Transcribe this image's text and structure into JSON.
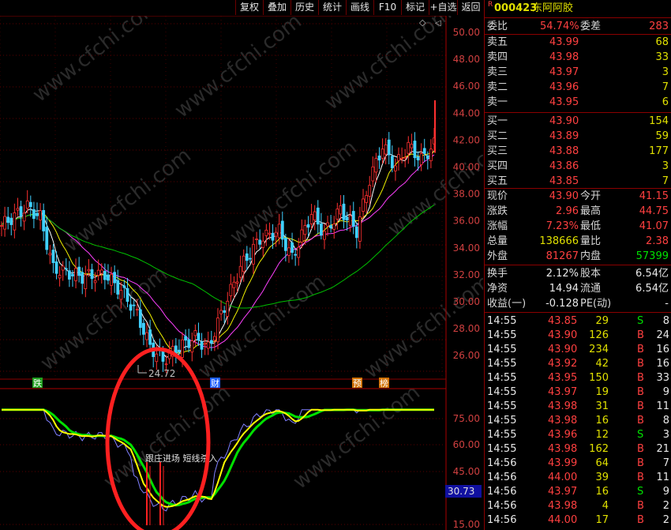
{
  "toolbar": {
    "items": [
      "复权",
      "叠加",
      "历史",
      "统计",
      "画线",
      "F10",
      "标记",
      "+自选",
      "返回"
    ]
  },
  "price_axis": [
    "50.00",
    "48.00",
    "46.00",
    "44.00",
    "42.00",
    "40.00",
    "38.00",
    "36.00",
    "34.00",
    "32.00",
    "30.00",
    "28.00",
    "26.00"
  ],
  "indicator_axis": [
    "75.00",
    "60.00",
    "45.00",
    "15.00"
  ],
  "indicator_value": "30.73",
  "low_marker": "24.72",
  "event_markers": [
    "跌",
    "财",
    "预",
    "榜"
  ],
  "signal_text": "跟庄进场 短线杀入",
  "watermark": "www.cfchi.com",
  "quote": {
    "marker": "R",
    "code": "000423",
    "name": "东阿阿胶",
    "weibi_label": "委比",
    "weibi": "54.74%",
    "weicha_label": "委差",
    "weicha": "283",
    "asks": [
      {
        "label": "卖五",
        "price": "43.99",
        "vol": "68"
      },
      {
        "label": "卖四",
        "price": "43.98",
        "vol": "33"
      },
      {
        "label": "卖三",
        "price": "43.97",
        "vol": "3"
      },
      {
        "label": "卖二",
        "price": "43.96",
        "vol": "7"
      },
      {
        "label": "卖一",
        "price": "43.95",
        "vol": "6"
      }
    ],
    "bids": [
      {
        "label": "买一",
        "price": "43.90",
        "vol": "154"
      },
      {
        "label": "买二",
        "price": "43.89",
        "vol": "59"
      },
      {
        "label": "买三",
        "price": "43.88",
        "vol": "177"
      },
      {
        "label": "买四",
        "price": "43.86",
        "vol": "3"
      },
      {
        "label": "买五",
        "price": "43.85",
        "vol": "7"
      }
    ],
    "stats": [
      {
        "l1": "现价",
        "v1": "43.90",
        "c1": "red",
        "l2": "今开",
        "v2": "41.15",
        "c2": "red"
      },
      {
        "l1": "涨跌",
        "v1": "2.96",
        "c1": "red",
        "l2": "最高",
        "v2": "44.75",
        "c2": "red"
      },
      {
        "l1": "涨幅",
        "v1": "7.23%",
        "c1": "red",
        "l2": "最低",
        "v2": "41.07",
        "c2": "red"
      },
      {
        "l1": "总量",
        "v1": "138666",
        "c1": "yellow",
        "l2": "量比",
        "v2": "2.38",
        "c2": "red"
      },
      {
        "l1": "外盘",
        "v1": "81267",
        "c1": "red",
        "l2": "内盘",
        "v2": "57399",
        "c2": "green"
      }
    ],
    "stats2": [
      {
        "l1": "换手",
        "v1": "2.12%",
        "l2": "股本",
        "v2": "6.54亿"
      },
      {
        "l1": "净资",
        "v1": "14.94",
        "l2": "流通",
        "v2": "6.54亿"
      },
      {
        "l1": "收益(一)",
        "v1": "-0.128",
        "l2": "PE(动)",
        "v2": "-"
      }
    ],
    "ticks": [
      {
        "t": "14:55",
        "p": "43.85",
        "v": "29",
        "s": "S",
        "n": "8"
      },
      {
        "t": "14:55",
        "p": "43.90",
        "v": "126",
        "s": "B",
        "n": "24"
      },
      {
        "t": "14:55",
        "p": "43.90",
        "v": "234",
        "s": "B",
        "n": "16"
      },
      {
        "t": "14:55",
        "p": "43.92",
        "v": "42",
        "s": "B",
        "n": "16"
      },
      {
        "t": "14:55",
        "p": "43.95",
        "v": "150",
        "s": "B",
        "n": "33"
      },
      {
        "t": "14:55",
        "p": "43.97",
        "v": "19",
        "s": "B",
        "n": "9"
      },
      {
        "t": "14:55",
        "p": "43.98",
        "v": "31",
        "s": "B",
        "n": "11"
      },
      {
        "t": "14:55",
        "p": "43.98",
        "v": "16",
        "s": "B",
        "n": "8"
      },
      {
        "t": "14:55",
        "p": "43.96",
        "v": "12",
        "s": "S",
        "n": "3"
      },
      {
        "t": "14:55",
        "p": "43.98",
        "v": "162",
        "s": "B",
        "n": "21"
      },
      {
        "t": "14:56",
        "p": "43.99",
        "v": "64",
        "s": "B",
        "n": "7"
      },
      {
        "t": "14:56",
        "p": "44.00",
        "v": "39",
        "s": "B",
        "n": "11"
      },
      {
        "t": "14:56",
        "p": "43.97",
        "v": "16",
        "s": "S",
        "n": "9"
      },
      {
        "t": "14:56",
        "p": "43.98",
        "v": "4",
        "s": "B",
        "n": "2"
      },
      {
        "t": "14:56",
        "p": "44.00",
        "v": "17",
        "s": "B",
        "n": "2"
      }
    ]
  }
}
